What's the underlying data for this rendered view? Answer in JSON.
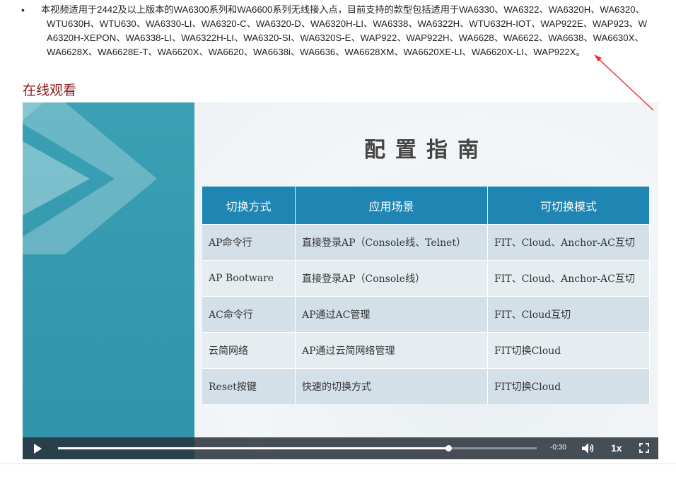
{
  "intro": {
    "bullet": "•",
    "text": "本视频适用于2442及以上版本的WA6300系列和WA6600系列无线接入点，目前支持的款型包括适用于WA6330、WA6322、WA6320H、WA6320、WTU630H、WTU630、WA6330-LI、WA6320-C、WA6320-D、WA6320H-LI、WA6338、WA6322H、WTU632H-IOT、WAP922E、WAP923、WA6320H-XEPON、WA6338-LI、WA6322H-LI、WA6320-SI、WA6320S-E、WAP922、WAP922H、WA6628、WA6622、WA6638、WA6630X、WA6628X、WA6628E-T、WA6620X、WA6620、WA6638i、WA6636、WA6628XM、WA6620XE-LI、WA6620X-LI、WAP922X。"
  },
  "section": {
    "title": "在线观看"
  },
  "slide": {
    "title": "配置指南",
    "headers": [
      "切换方式",
      "应用场景",
      "可切换模式"
    ],
    "rows": [
      [
        "AP命令行",
        "直接登录AP（Console线、Telnet）",
        "FIT、Cloud、Anchor-AC互切"
      ],
      [
        "AP Bootware",
        "直接登录AP（Console线）",
        "FIT、Cloud、Anchor-AC互切"
      ],
      [
        "AC命令行",
        "AP通过AC管理",
        "FIT、Cloud互切"
      ],
      [
        "云简网络",
        "AP通过云简网络管理",
        "FIT切换Cloud"
      ],
      [
        "Reset按键",
        "快速的切换方式",
        "FIT切换Cloud"
      ]
    ]
  },
  "player": {
    "time_remaining": "-0:30",
    "speed": "1x",
    "progress": 0.815
  },
  "icons": {
    "play": "play-icon",
    "volume": "volume-icon",
    "fullscreen": "fullscreen-icon"
  },
  "colors": {
    "section_title": "#8b1a1a",
    "table_header": "#1f86b3",
    "left_panel": "#3aa0b4",
    "annotation_arrow": "#e53935"
  }
}
